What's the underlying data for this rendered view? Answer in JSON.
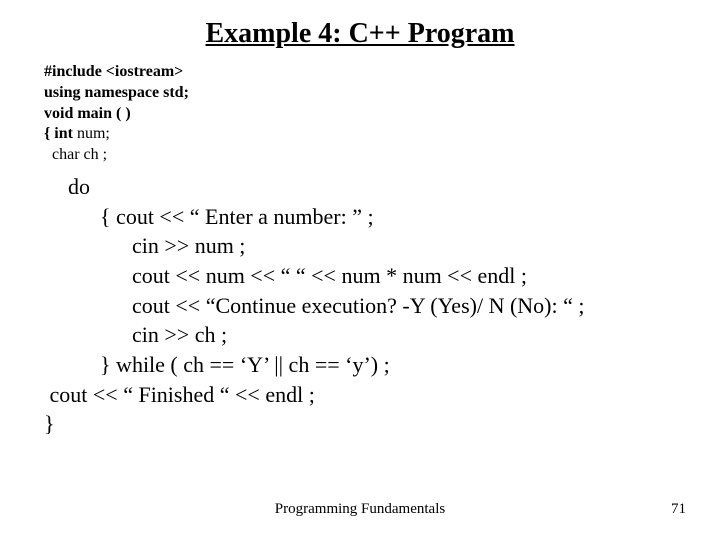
{
  "title": "Example 4: C++ Program",
  "code_small": {
    "l1": "#include <iostream>",
    "l2": "using namespace std;",
    "l3": "void main ( )",
    "l4a": "{ int",
    "l4b": " num;",
    "l5": "  char ch ;"
  },
  "code_large": {
    "l1": "do",
    "l2": "{ cout << “ Enter a number: ” ;",
    "l3": "cin >> num ;",
    "l4": "cout << num << “      “ <<  num * num << endl ;",
    "l5": "cout <<  “Continue execution? -Y (Yes)/ N (No): “ ;",
    "l6": "cin >> ch ;",
    "l7": "} while  ( ch == ‘Y’ ||  ch == ‘y’)  ;",
    "l8": " cout << “ Finished “ << endl ;",
    "l9": "}"
  },
  "footer": {
    "center": "Programming Fundamentals",
    "page": "71"
  }
}
